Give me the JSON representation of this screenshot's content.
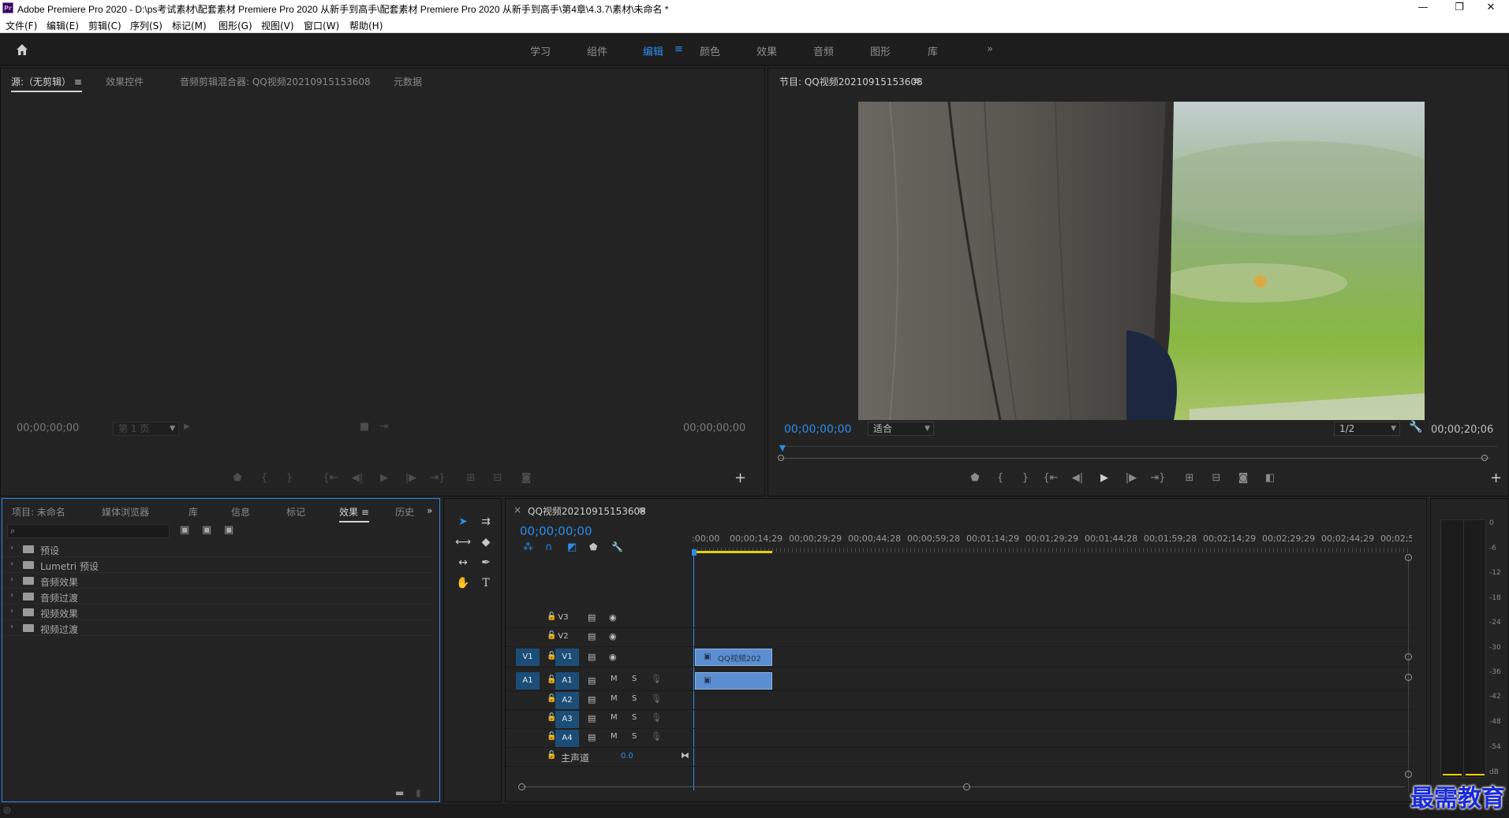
{
  "window": {
    "app_icon": "Pr",
    "title": "Adobe Premiere Pro 2020 - D:\\ps考试素材\\配套素材 Premiere Pro 2020 从新手到高手\\配套素材 Premiere Pro 2020 从新手到高手\\第4章\\4.3.7\\素材\\未命名 *",
    "minimize": "—",
    "restore": "❐",
    "close": "✕"
  },
  "menu": [
    "文件(F)",
    "编辑(E)",
    "剪辑(C)",
    "序列(S)",
    "标记(M)",
    "图形(G)",
    "视图(V)",
    "窗口(W)",
    "帮助(H)"
  ],
  "workspaces": {
    "home_icon": "home-icon",
    "tabs": [
      "学习",
      "组件",
      "编辑",
      "颜色",
      "效果",
      "音频",
      "图形",
      "库"
    ],
    "active": "编辑",
    "menu_glyph": "≡",
    "more": "»"
  },
  "source_panel": {
    "tabs": [
      "源:（无剪辑）",
      "效果控件",
      "音频剪辑混合器: QQ视频20210915153608",
      "元数据"
    ],
    "tab_menu": "≡",
    "timecode_left": "00;00;00;00",
    "page_select": "第 1 页",
    "timecode_right": "00;00;00;00",
    "add": "+"
  },
  "program_panel": {
    "title": "节目: QQ视频20210915153608",
    "title_menu": "≡",
    "timecode": "00;00;00;00",
    "fit": "适合",
    "resolution": "1/2",
    "duration": "00;00;20;06",
    "add": "+"
  },
  "project_panel": {
    "tabs": [
      "项目: 未命名",
      "媒体浏览器",
      "库",
      "信息",
      "标记",
      "效果",
      "历史"
    ],
    "active": "效果",
    "tab_menu": "≡",
    "more": "»",
    "search_placeholder": "",
    "items": [
      "预设",
      "Lumetri 预设",
      "音频效果",
      "音频过渡",
      "视频效果",
      "视频过渡"
    ]
  },
  "timeline": {
    "close": "×",
    "sequence_name": "QQ视频20210915153608",
    "menu": "≡",
    "timecode": "00;00;00;00",
    "ruler": [
      ":00;00",
      "00;00;14;29",
      "00;00;29;29",
      "00;00;44;28",
      "00;00;59;28",
      "00;01;14;29",
      "00;01;29;29",
      "00;01;44;28",
      "00;01;59;28",
      "00;02;14;29",
      "00;02;29;29",
      "00;02;44;29",
      "00;02;5"
    ],
    "video_tracks": [
      "V3",
      "V2",
      "V1"
    ],
    "audio_tracks": [
      "A1",
      "A2",
      "A3",
      "A4"
    ],
    "source_patch_video": "V1",
    "source_patch_audio": "A1",
    "mute": "M",
    "solo": "S",
    "master_label": "主声道",
    "master_value": "0.0",
    "clip_name": "QQ视频202"
  },
  "audio_meter": {
    "scale": [
      "0",
      "-6",
      "-12",
      "-18",
      "-24",
      "-30",
      "-36",
      "-42",
      "-48",
      "-54",
      "dB"
    ]
  },
  "watermark": "最需教育",
  "colors": {
    "accent": "#2d8ceb",
    "panel_bg": "#232323",
    "clip_video": "#5b8ed1",
    "track_active": "#1c4d77",
    "work_area": "#e5d400"
  }
}
